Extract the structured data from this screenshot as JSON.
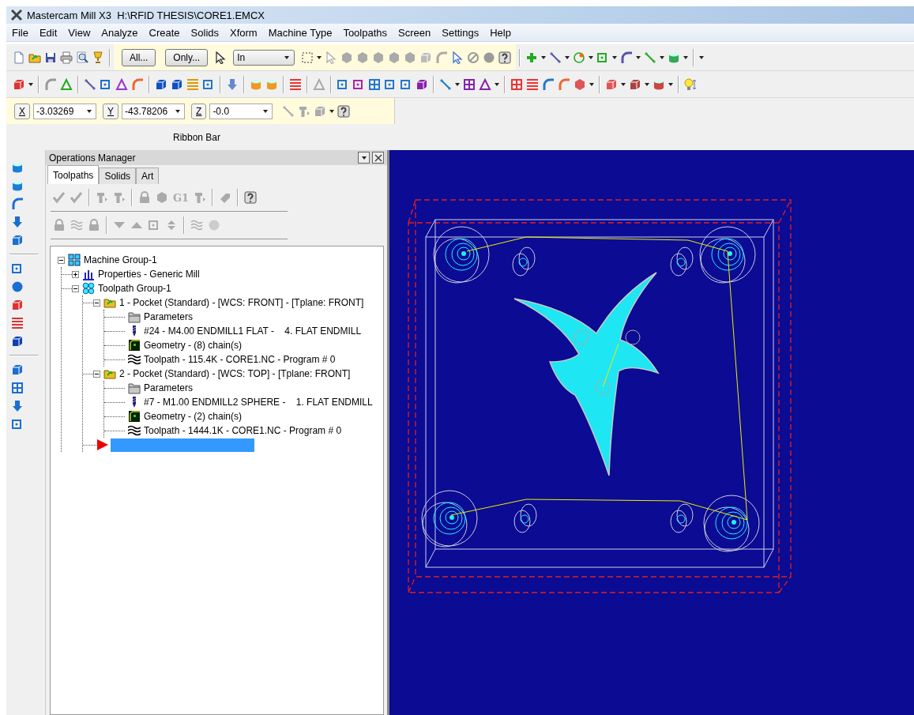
{
  "window": {
    "title": "Mastercam Mill X3  H:\\RFID THESIS\\CORE1.EMCX"
  },
  "menu": [
    "File",
    "Edit",
    "View",
    "Analyze",
    "Create",
    "Solids",
    "Xform",
    "Machine Type",
    "Toolpaths",
    "Screen",
    "Settings",
    "Help"
  ],
  "toolbar": {
    "buttons": [
      "All...",
      "Only..."
    ],
    "units": "In"
  },
  "coordinates": [
    {
      "axis": "X",
      "value": "-3.03269"
    },
    {
      "axis": "Y",
      "value": "-43.78206"
    },
    {
      "axis": "Z",
      "value": "-0.0"
    }
  ],
  "ribbon_bar": {
    "label": "Ribbon Bar"
  },
  "operations_manager": {
    "title": "Operations Manager",
    "tabs": [
      {
        "label": "Toolpaths",
        "selected": true
      },
      {
        "label": "Solids",
        "selected": false
      },
      {
        "label": "Art",
        "selected": false
      }
    ],
    "toolbar_label": "G1",
    "tree": [
      {
        "kind": "machine-group",
        "label": "Machine Group-1",
        "expanded": true,
        "children": [
          {
            "kind": "properties",
            "label": "Properties - Generic Mill",
            "expanded": false
          },
          {
            "kind": "toolpath-group",
            "label": "Toolpath Group-1",
            "expanded": true,
            "children": [
              {
                "kind": "operation",
                "label": "1 - Pocket (Standard) - [WCS: FRONT] - [Tplane: FRONT]",
                "expanded": true,
                "children": [
                  {
                    "kind": "parameters",
                    "label": "Parameters"
                  },
                  {
                    "kind": "tool",
                    "label": "#24 - M4.00 ENDMILL1 FLAT -    4. FLAT ENDMILL"
                  },
                  {
                    "kind": "geometry",
                    "label": "Geometry - (8) chain(s)"
                  },
                  {
                    "kind": "toolpath",
                    "label": "Toolpath - 115.4K - CORE1.NC - Program # 0"
                  }
                ]
              },
              {
                "kind": "operation",
                "label": "2 - Pocket (Standard) - [WCS: TOP] - [Tplane: FRONT]",
                "expanded": true,
                "children": [
                  {
                    "kind": "parameters",
                    "label": "Parameters"
                  },
                  {
                    "kind": "tool",
                    "label": "#7 - M1.00 ENDMILL2 SPHERE -    1. FLAT ENDMILL"
                  },
                  {
                    "kind": "geometry",
                    "label": "Geometry - (2) chain(s)"
                  },
                  {
                    "kind": "toolpath",
                    "label": "Toolpath - 1444.1K - CORE1.NC - Program # 0"
                  }
                ]
              },
              {
                "kind": "insert-marker",
                "selected": true
              }
            ]
          }
        ]
      }
    ]
  }
}
